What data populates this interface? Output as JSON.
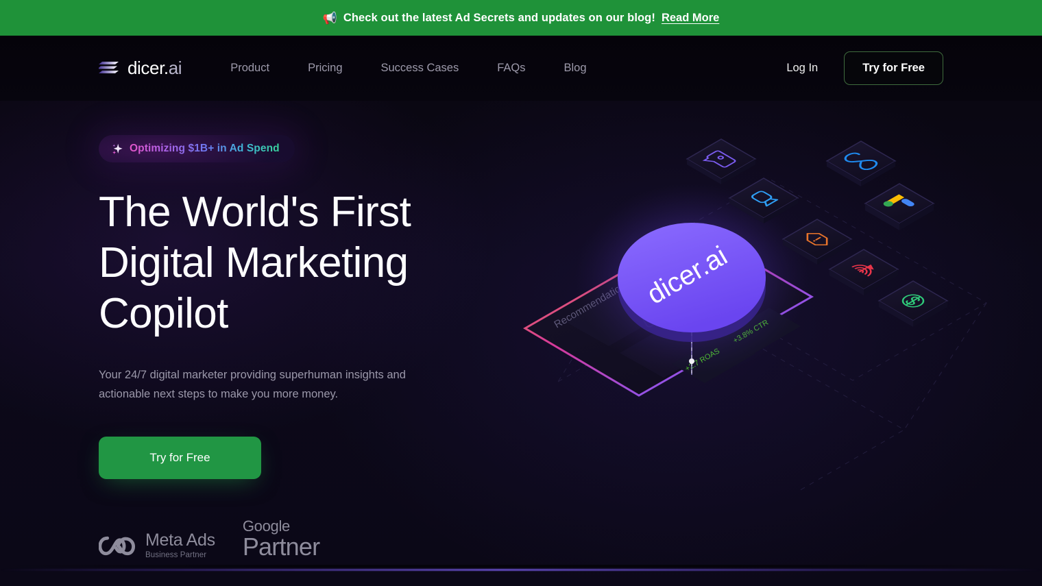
{
  "banner": {
    "icon": "megaphone-icon",
    "text": "Check out the latest Ad Secrets and updates on our blog!",
    "link_label": "Read More",
    "background": "#1f9239"
  },
  "nav": {
    "logo": {
      "name": "dicer",
      "dot": ".",
      "suffix": "ai",
      "mark": "stacked-bars-icon"
    },
    "links": [
      {
        "label": "Product"
      },
      {
        "label": "Pricing"
      },
      {
        "label": "Success Cases"
      },
      {
        "label": "FAQs"
      },
      {
        "label": "Blog"
      }
    ],
    "login_label": "Log In",
    "cta_label": "Try for Free",
    "cta_border_color": "#3f6b3d"
  },
  "hero": {
    "badge": {
      "icon": "sparkle-icon",
      "text": "Optimizing $1B+ in Ad Spend",
      "gradient_start": "#e455c8",
      "gradient_end": "#38d39a"
    },
    "headline": "The World's First Digital Marketing Copilot",
    "subhead": "Your 24/7 digital marketer providing superhuman insights and actionable next steps to make you more money.",
    "cta_label": "Try for Free",
    "cta_color": "#219644",
    "partners": [
      {
        "icon": "meta-infinity-icon",
        "title": "Meta Ads",
        "subtitle": "Business Partner"
      },
      {
        "icon": "google-wordmark",
        "title": "Google",
        "subtitle": "Partner"
      }
    ]
  },
  "artwork": {
    "center_label": "dicer.ai",
    "panel_label": "Recommendations",
    "metrics": [
      {
        "label": "+2.7 ROAS",
        "color": "#4fc42a"
      },
      {
        "label": "+3.8% CTR",
        "color": "#4fc42a"
      }
    ],
    "tiles": [
      {
        "name": "chat-analytics-icon",
        "color": "#7b5cf0"
      },
      {
        "name": "video-camera-icon",
        "color": "#2f9ff5"
      },
      {
        "name": "meta-infinity-icon",
        "color": "#1f8bf0"
      },
      {
        "name": "google-ads-icon",
        "color": "#4285f4"
      },
      {
        "name": "alert-diamond-icon",
        "color": "#e8742b"
      },
      {
        "name": "target-bullseye-icon",
        "color": "#e8354a"
      },
      {
        "name": "dollar-circle-icon",
        "color": "#2fc979"
      }
    ]
  }
}
